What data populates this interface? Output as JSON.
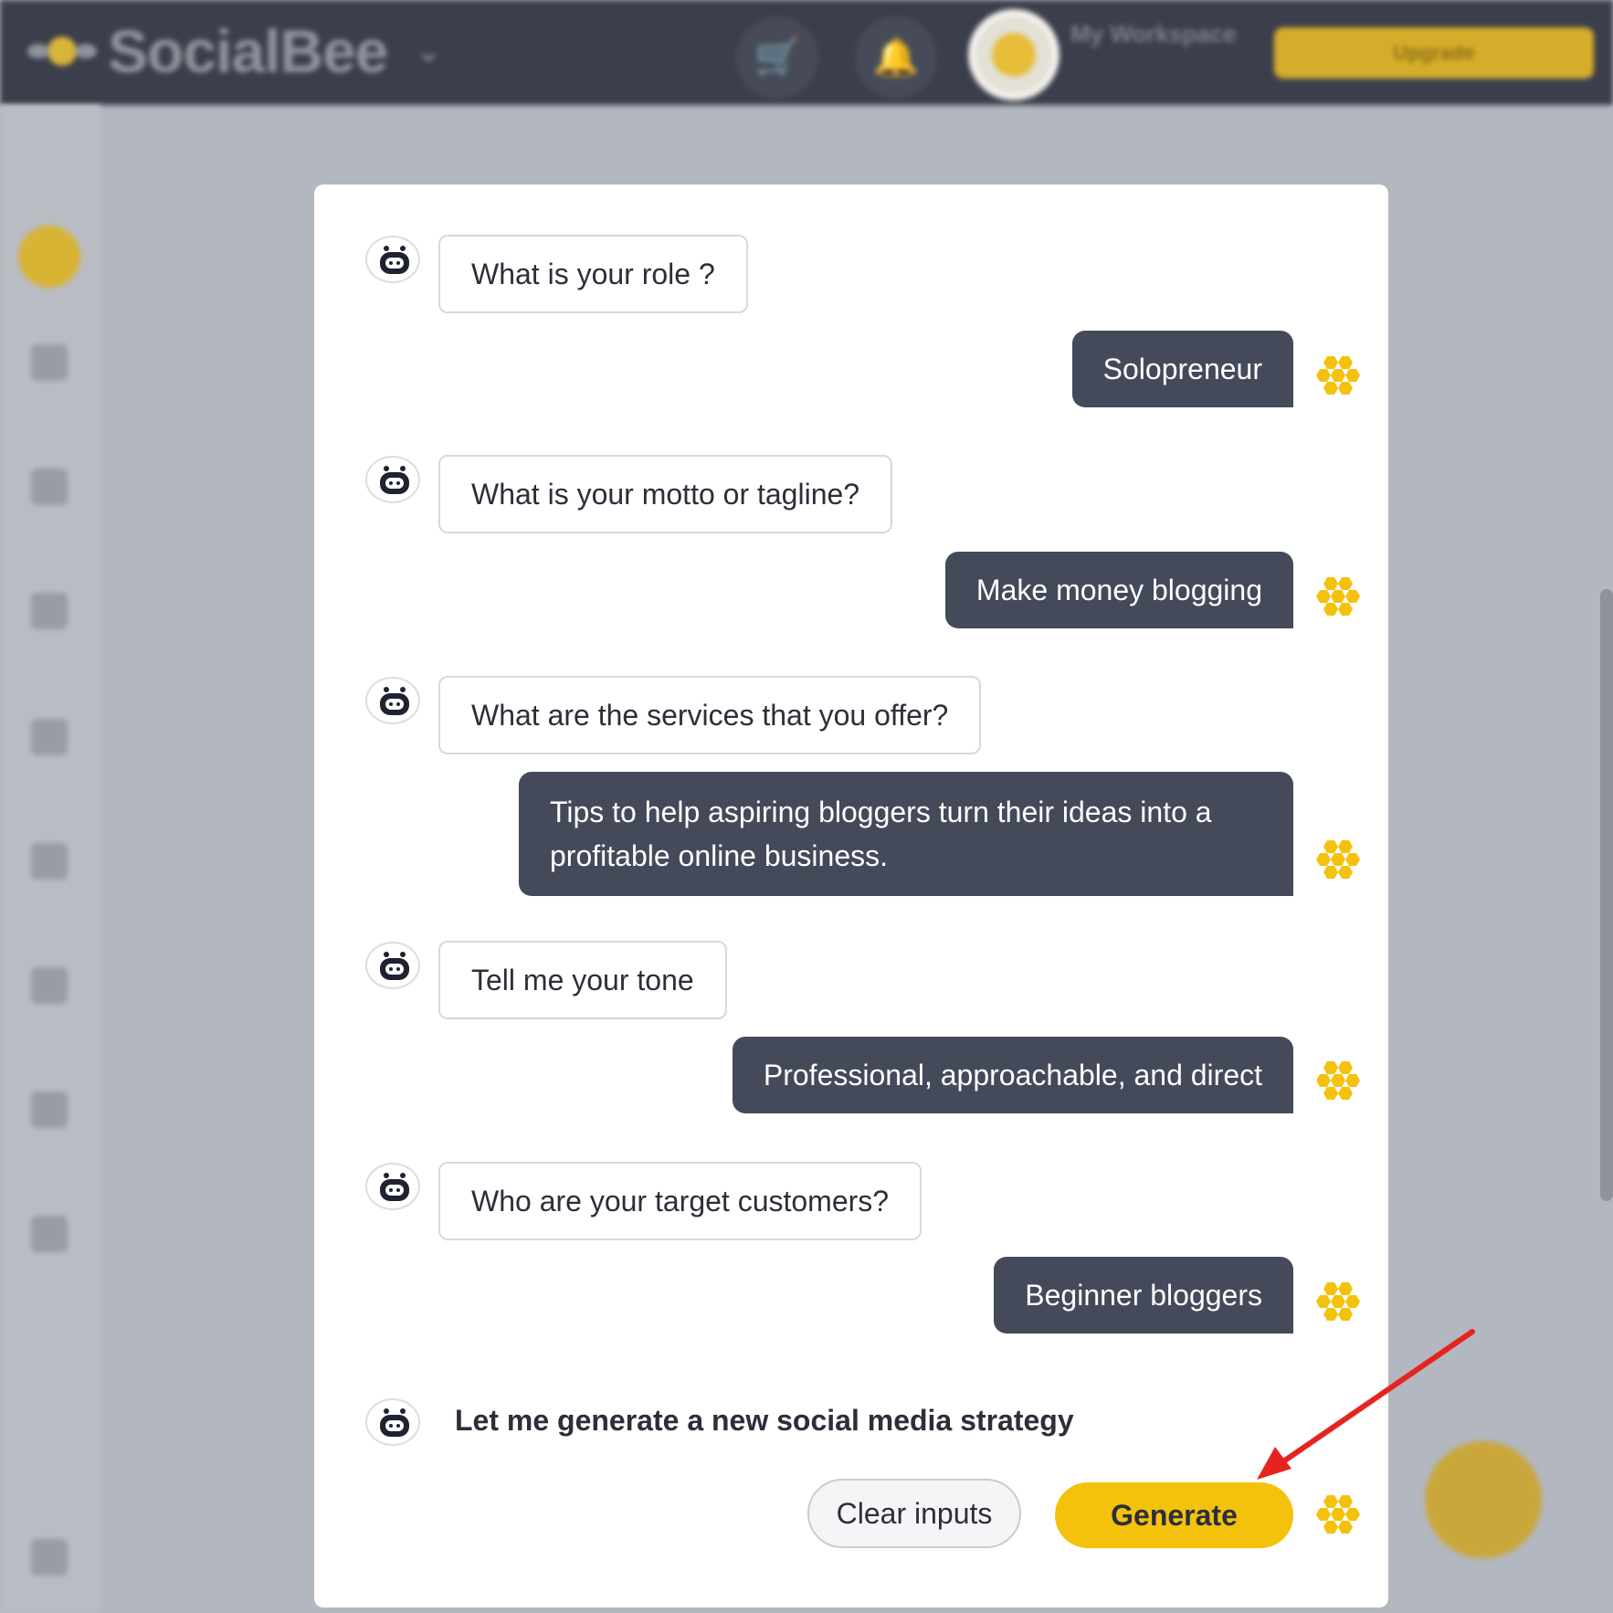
{
  "topbar": {
    "brand": "SocialBee",
    "workspace": "My Workspace",
    "upgrade_label": "Upgrade"
  },
  "conversation": [
    {
      "question": "What is your role ?",
      "answer": "Solopreneur"
    },
    {
      "question": "What is your motto or tagline?",
      "answer": "Make money blogging"
    },
    {
      "question": "What are the services that you offer?",
      "answer": "Tips to help aspiring bloggers turn their ideas into a profitable online business."
    },
    {
      "question": "Tell me your tone",
      "answer": "Professional, approachable, and direct"
    },
    {
      "question": "Who are your target customers?",
      "answer": "Beginner bloggers"
    }
  ],
  "final_prompt": "Let me generate a new social media strategy",
  "actions": {
    "clear_label": "Clear inputs",
    "generate_label": "Generate"
  },
  "colors": {
    "accent": "#f4c20d",
    "answer_bubble": "#454a5a",
    "honeycomb": "#f4c20d",
    "annotation_arrow": "#e52420"
  },
  "icons": {
    "bot": "bot-avatar-icon",
    "user": "honeycomb-icon",
    "cart": "cart-icon",
    "notifications": "bell-icon"
  }
}
